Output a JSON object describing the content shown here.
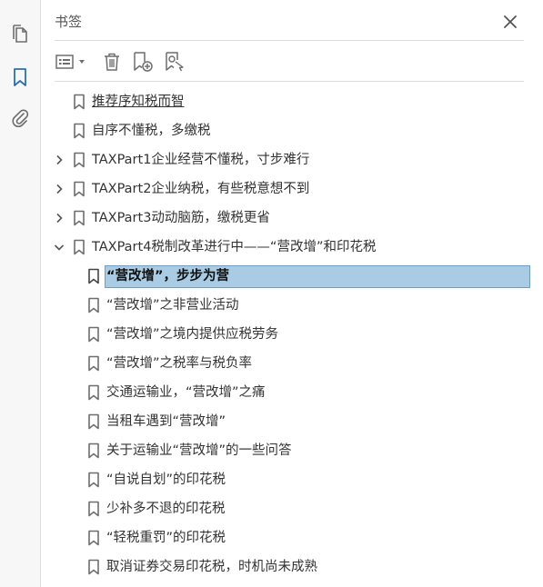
{
  "panel": {
    "title": "书签"
  },
  "sidebar": {
    "buttons": [
      {
        "name": "pages-thumbnails-icon"
      },
      {
        "name": "bookmarks-icon",
        "active": true
      },
      {
        "name": "attachments-icon"
      }
    ]
  },
  "toolbar": {
    "options_icon": "list-options-icon",
    "delete_icon": "trash-icon",
    "new_bookmark_icon": "new-bookmark-icon",
    "bookmark_from_selection_icon": "bookmark-search-icon"
  },
  "colors": {
    "accent": "#2a6fb4",
    "selection_bg": "#a9cbe3",
    "selection_border": "#6b9ec8",
    "icon_gray": "#6e6e6e"
  },
  "bookmarks": [
    {
      "label": "推荐序知税而智",
      "level": 0
    },
    {
      "label": "自序不懂税，多缴税",
      "level": 0
    },
    {
      "label": "TAXPart1企业经营不懂税，寸步难行",
      "level": 0,
      "expander": "collapsed"
    },
    {
      "label": "TAXPart2企业纳税，有些税意想不到",
      "level": 0,
      "expander": "collapsed"
    },
    {
      "label": "TAXPart3动动脑筋，缴税更省",
      "level": 0,
      "expander": "collapsed"
    },
    {
      "label": "TAXPart4税制改革进行中——“营改增”和印花税",
      "level": 0,
      "expander": "expanded"
    },
    {
      "label": "“营改增”，步步为营",
      "level": 1,
      "selected": true
    },
    {
      "label": "“营改增”之非营业活动",
      "level": 1
    },
    {
      "label": "“营改增”之境内提供应税劳务",
      "level": 1
    },
    {
      "label": "“营改增”之税率与税负率",
      "level": 1
    },
    {
      "label": "交通运输业，“营改增”之痛",
      "level": 1
    },
    {
      "label": "当租车遇到“营改增”",
      "level": 1
    },
    {
      "label": "关于运输业“营改增”的一些问答",
      "level": 1
    },
    {
      "label": "“自说自划”的印花税",
      "level": 1
    },
    {
      "label": "少补多不退的印花税",
      "level": 1
    },
    {
      "label": "“轻税重罚”的印花税",
      "level": 1
    },
    {
      "label": "取消证券交易印花税，时机尚未成熟",
      "level": 1
    }
  ]
}
